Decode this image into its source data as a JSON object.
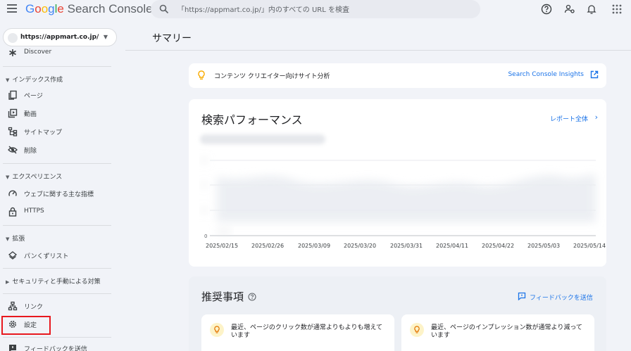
{
  "header": {
    "logo_google": "Google",
    "logo_product": "Search Console",
    "search_placeholder": "「https://appmart.co.jp/」内のすべての URL を検査"
  },
  "sidebar": {
    "property": "https://appmart.co.jp/",
    "discover": "Discover",
    "sections": {
      "index": "インデックス作成",
      "experience": "エクスペリエンス",
      "enhancements": "拡張",
      "security": "セキュリティと手動による対策"
    },
    "items": {
      "pages": "ページ",
      "videos": "動画",
      "sitemaps": "サイトマップ",
      "removals": "削除",
      "cwv": "ウェブに関する主な指標",
      "https": "HTTPS",
      "breadcrumbs": "パンくずリスト",
      "links": "リンク",
      "settings": "設定",
      "feedback": "フィードバックを送信"
    }
  },
  "main": {
    "title": "サマリー",
    "insights": {
      "title": "コンテンツ クリエイター向けサイト分析",
      "link": "Search Console Insights"
    },
    "performance": {
      "title": "検索パフォーマンス",
      "link": "レポート全体",
      "zero_label": "0",
      "dates": [
        "2025/02/15",
        "2025/02/26",
        "2025/03/09",
        "2025/03/20",
        "2025/03/31",
        "2025/04/11",
        "2025/04/22",
        "2025/05/03",
        "2025/05/14"
      ]
    },
    "recommendations": {
      "title": "推奨事項",
      "feedback": "フィードバックを送信",
      "items": [
        "最近、ページのクリック数が通常よりもよりも増えています",
        "最近、ページのインプレッション数が通常より減っています"
      ]
    }
  }
}
